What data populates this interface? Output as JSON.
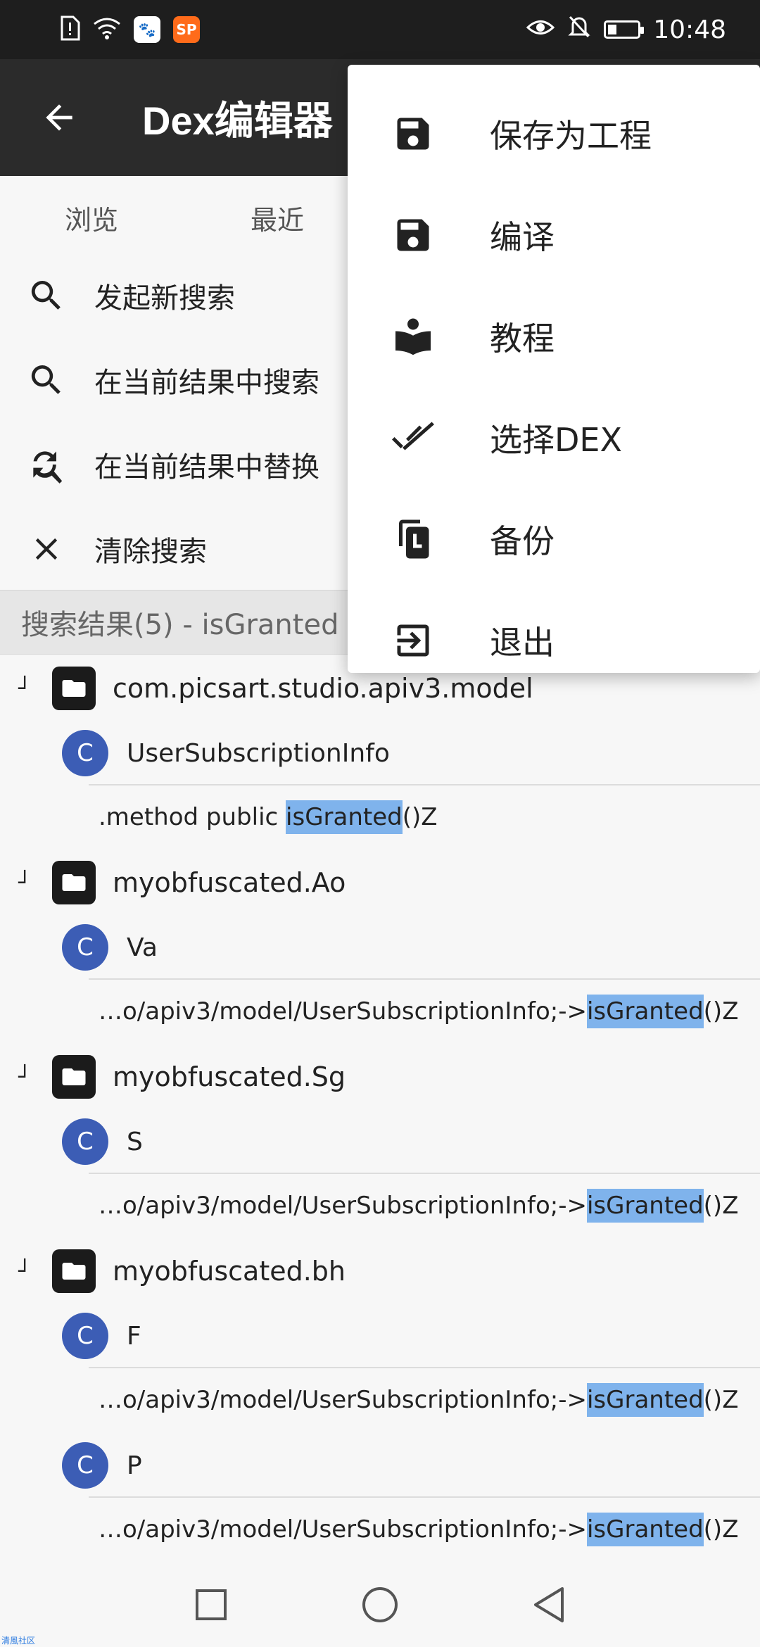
{
  "status_bar": {
    "time": "10:48",
    "badge_orange_text": "SP"
  },
  "toolbar": {
    "title": "Dex编辑器"
  },
  "tabs": [
    {
      "label": "浏览"
    },
    {
      "label": "最近"
    }
  ],
  "search_actions": [
    {
      "label": "发起新搜索",
      "icon": "search-icon"
    },
    {
      "label": "在当前结果中搜索",
      "icon": "search-icon"
    },
    {
      "label": "在当前结果中替换",
      "icon": "find-replace-icon"
    },
    {
      "label": "清除搜索",
      "icon": "close-icon"
    }
  ],
  "results_header": "搜索结果(5) - isGranted",
  "results": {
    "groups": [
      {
        "package": "com.picsart.studio.apiv3.model",
        "class": "UserSubscriptionInfo",
        "method_pre": ".method public ",
        "method_hl": "isGranted",
        "method_post": "()Z"
      },
      {
        "package": "myobfuscated.Ao",
        "class": "Va",
        "method_pre": "…o/apiv3/model/UserSubscriptionInfo;->",
        "method_hl": "isGranted",
        "method_post": "()Z"
      },
      {
        "package": "myobfuscated.Sg",
        "class": "S",
        "method_pre": "…o/apiv3/model/UserSubscriptionInfo;->",
        "method_hl": "isGranted",
        "method_post": "()Z"
      },
      {
        "package": "myobfuscated.bh",
        "class": "F",
        "method_pre": "…o/apiv3/model/UserSubscriptionInfo;->",
        "method_hl": "isGranted",
        "method_post": "()Z",
        "class2": "P",
        "method2_pre": "…o/apiv3/model/UserSubscriptionInfo;->",
        "method2_hl": "isGranted",
        "method2_post": "()Z"
      }
    ],
    "class_badge_letter": "C",
    "tree_mark": "┘"
  },
  "menu": {
    "items": [
      {
        "label": "保存为工程",
        "icon": "save-icon"
      },
      {
        "label": "编译",
        "icon": "save-icon"
      },
      {
        "label": "教程",
        "icon": "book-reader-icon"
      },
      {
        "label": "选择DEX",
        "icon": "double-check-icon"
      },
      {
        "label": "备份",
        "icon": "copy-icon"
      },
      {
        "label": "退出",
        "icon": "exit-icon"
      }
    ]
  },
  "watermark": "清風社区",
  "colors": {
    "toolbar": "#2b2b2b",
    "class_badge": "#3c5db5",
    "highlight": "#7fb3ec"
  }
}
